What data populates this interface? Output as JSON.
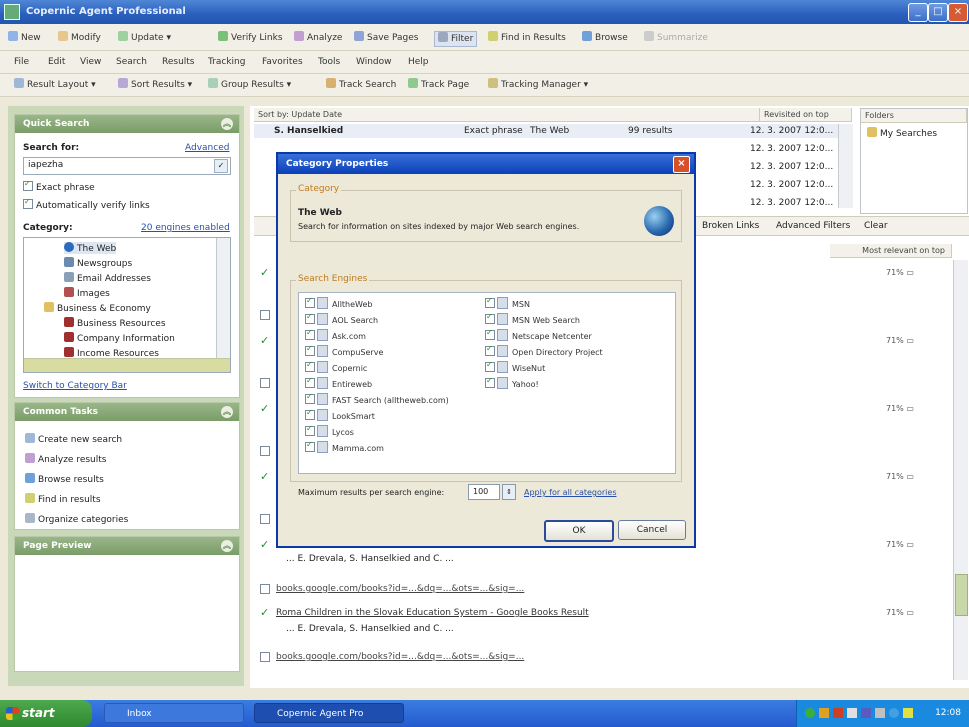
{
  "window": {
    "title": "Copernic Agent Professional"
  },
  "toolbar1": [
    "New",
    "Modify",
    "Update",
    "Verify Links",
    "Analyze",
    "Save Pages",
    "Filter",
    "Find in Results",
    "Browse",
    "Summarize"
  ],
  "menu": [
    "File",
    "Edit",
    "View",
    "Search",
    "Results",
    "Tracking",
    "Favorites",
    "Tools",
    "Window",
    "Help"
  ],
  "toolbar3": [
    "Result Layout",
    "Sort Results",
    "Group Results",
    "Track Search",
    "Track Page",
    "Tracking Manager"
  ],
  "search_panel": {
    "header": "Quick Search",
    "search_for_label": "Search for:",
    "advanced_link": "Advanced",
    "query": "iapezha",
    "exact_phrase": "Exact phrase",
    "auto_verify": "Automatically verify links",
    "category_label": "Category:",
    "engines_enabled": "20 engines enabled",
    "categories": [
      "The Web",
      "Newsgroups",
      "Email Addresses",
      "Images",
      "Business & Economy",
      "Business Resources",
      "Company Information",
      "Income Resources"
    ],
    "switch_link": "Switch to Category Bar"
  },
  "common_tasks": {
    "header": "Common Tasks",
    "items": [
      "Create new search",
      "Analyze results",
      "Browse results",
      "Find in results",
      "Organize categories"
    ]
  },
  "page_preview": {
    "header": "Page Preview"
  },
  "searches_list": {
    "sort_header": "Sort by: Update Date",
    "col_date": "Revisited on top",
    "first_row": {
      "query": "S. Hanselkied",
      "type": "Exact phrase",
      "category": "The Web",
      "results": "99 results",
      "date": "12. 3. 2007 12:0..."
    },
    "other_dates": [
      "12. 3. 2007 12:0...",
      "12. 3. 2007 12:0...",
      "12. 3. 2007 12:0...",
      "12. 3. 2007 12:0..."
    ]
  },
  "folders": {
    "header": "Folders",
    "item": "My Searches"
  },
  "filter_bar": {
    "broken_links": "Broken Links",
    "advanced_filters": "Advanced Filters",
    "clear": "Clear"
  },
  "results": {
    "col_header": "Most relevant on top",
    "percents": [
      "71%",
      "71%",
      "71%",
      "71%",
      "71%",
      "71%"
    ],
    "snippet": "... E. Drevala, S. Hanselkied and C. ...",
    "url": "books.google.com/books?id=...&dq=...&ots=...&sig=...",
    "title2": "Roma Children in the Slovak Education System - Google Books Result",
    "snippet2": "... E. Drevala, S. Hanselkied and C. ..."
  },
  "dialog": {
    "title": "Category Properties",
    "category_group": "Category",
    "category_name": "The Web",
    "category_desc": "Search for information on sites indexed by major Web search engines.",
    "engines_group": "Search Engines",
    "engines_left": [
      "AlltheWeb",
      "AOL Search",
      "Ask.com",
      "CompuServe",
      "Copernic",
      "Entireweb",
      "FAST Search (alltheweb.com)",
      "LookSmart",
      "Lycos",
      "Mamma.com"
    ],
    "engines_right": [
      "MSN",
      "MSN Web Search",
      "Netscape Netcenter",
      "Open Directory Project",
      "WiseNut",
      "Yahoo!"
    ],
    "max_label": "Maximum results per search engine:",
    "max_value": "100",
    "apply_link": "Apply for all categories",
    "ok": "OK",
    "cancel": "Cancel"
  },
  "taskbar": {
    "start": "start",
    "task1": "Inbox",
    "task2": "Copernic Agent Pro",
    "clock": "12:08"
  }
}
